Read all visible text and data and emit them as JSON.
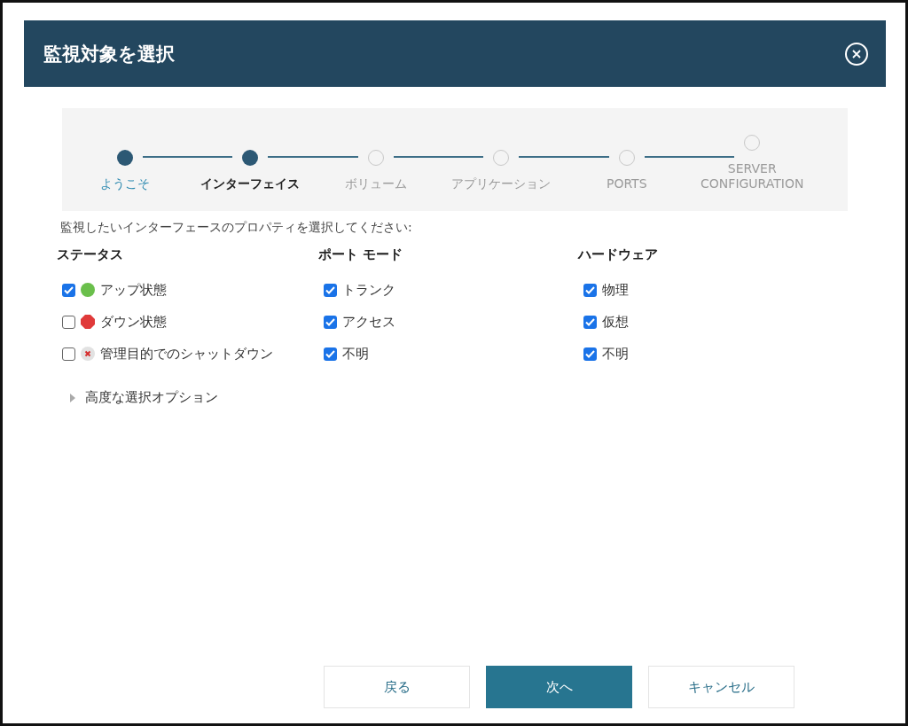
{
  "dialog": {
    "title": "監視対象を選択"
  },
  "steps": [
    {
      "label": "ようこそ",
      "completed": true,
      "selected": false
    },
    {
      "label": "インターフェイス",
      "completed": true,
      "selected": true
    },
    {
      "label": "ボリューム",
      "completed": false,
      "selected": false
    },
    {
      "label": "アプリケーション",
      "completed": false,
      "selected": false
    },
    {
      "label": "PORTS",
      "completed": false,
      "selected": false
    },
    {
      "label": "SERVER CONFIGURATION",
      "completed": false,
      "selected": false
    }
  ],
  "instruction": "監視したいインターフェースのプロパティを選択してください:",
  "groups": [
    {
      "title": "ステータス",
      "options": [
        {
          "label": "アップ状態",
          "checked": true,
          "kind": "up"
        },
        {
          "label": "ダウン状態",
          "checked": false,
          "kind": "down"
        },
        {
          "label": "管理目的でのシャットダウン",
          "checked": false,
          "kind": "admin-down"
        }
      ]
    },
    {
      "title": "ポート モード",
      "options": [
        {
          "label": "トランク",
          "checked": true
        },
        {
          "label": "アクセス",
          "checked": true
        },
        {
          "label": "不明",
          "checked": true
        }
      ]
    },
    {
      "title": "ハードウェア",
      "options": [
        {
          "label": "物理",
          "checked": true
        },
        {
          "label": "仮想",
          "checked": true
        },
        {
          "label": "不明",
          "checked": true
        }
      ]
    }
  ],
  "advanced": {
    "label": "高度な選択オプション",
    "expanded": false
  },
  "buttons": [
    {
      "label": "戻る",
      "kind": "secondary"
    },
    {
      "label": "次へ",
      "kind": "primary"
    },
    {
      "label": "キャンセル",
      "kind": "secondary"
    }
  ]
}
